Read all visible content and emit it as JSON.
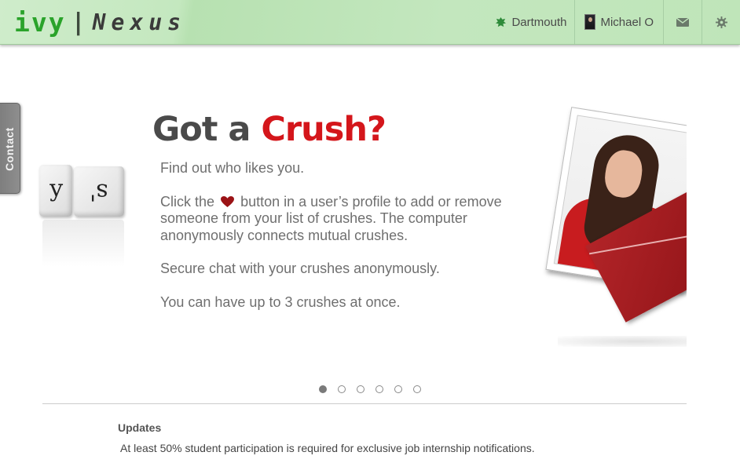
{
  "header": {
    "logo_ivy": "ivy",
    "logo_separator": "|",
    "logo_nexus": "Nexus",
    "school_label": "Dartmouth",
    "user_name": "Michael O",
    "icons": [
      "leaf-icon",
      "user-avatar",
      "mail-icon",
      "gear-icon"
    ],
    "colors": {
      "bar": "#c4e8bf",
      "logo_green": "#2aa32a"
    }
  },
  "contact_tab": {
    "label": "Contact"
  },
  "slide": {
    "headline_part1": "Got a ",
    "headline_part2": "Crush?",
    "line1": "Find out who likes you.",
    "line2_before_icon": "Click the",
    "line2_after_icon": "button in a user’s profile to add or remove someone from your list of crushes.  The computer anonymously connects mutual crushes.",
    "line3": "Secure chat with your crushes anonymously.",
    "line4": "You can have up to 3 crushes at once.",
    "accent_color": "#d4161b"
  },
  "pager": {
    "total": 6,
    "active_index": 0
  },
  "updates": {
    "title": "Updates",
    "text": "At least 50% student participation is required for exclusive job internship notifications."
  }
}
